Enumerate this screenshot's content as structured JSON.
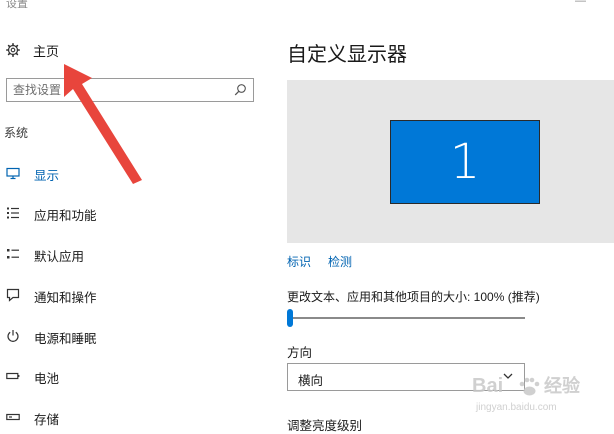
{
  "window": {
    "title": "设置",
    "minimize_glyph": "—"
  },
  "sidebar": {
    "home_label": "主页",
    "search": {
      "placeholder": "查找设置",
      "icon": "search-icon"
    },
    "section_label": "系统",
    "items": [
      {
        "label": "显示",
        "icon": "monitor-icon",
        "active": true
      },
      {
        "label": "应用和功能",
        "icon": "apps-list-icon",
        "active": false
      },
      {
        "label": "默认应用",
        "icon": "default-apps-icon",
        "active": false
      },
      {
        "label": "通知和操作",
        "icon": "notification-icon",
        "active": false
      },
      {
        "label": "电源和睡眠",
        "icon": "power-icon",
        "active": false
      },
      {
        "label": "电池",
        "icon": "battery-icon",
        "active": false
      },
      {
        "label": "存储",
        "icon": "storage-icon",
        "active": false
      }
    ]
  },
  "main": {
    "title": "自定义显示器",
    "monitor_number": "1",
    "identify_link": "标识",
    "detect_link": "检测",
    "scale_label": "更改文本、应用和其他项目的大小: 100% (推荐)",
    "scale_value_percent": 100,
    "orientation_label": "方向",
    "orientation_value": "横向",
    "brightness_label_partial": "调整亮度级别"
  },
  "watermark": {
    "brand": "Baidu经验",
    "url": "jingyan.baidu.com"
  },
  "colors": {
    "accent": "#0078d7",
    "link": "#0063b1",
    "arrow": "#e8453c",
    "display_bg": "#e6e6e6"
  }
}
